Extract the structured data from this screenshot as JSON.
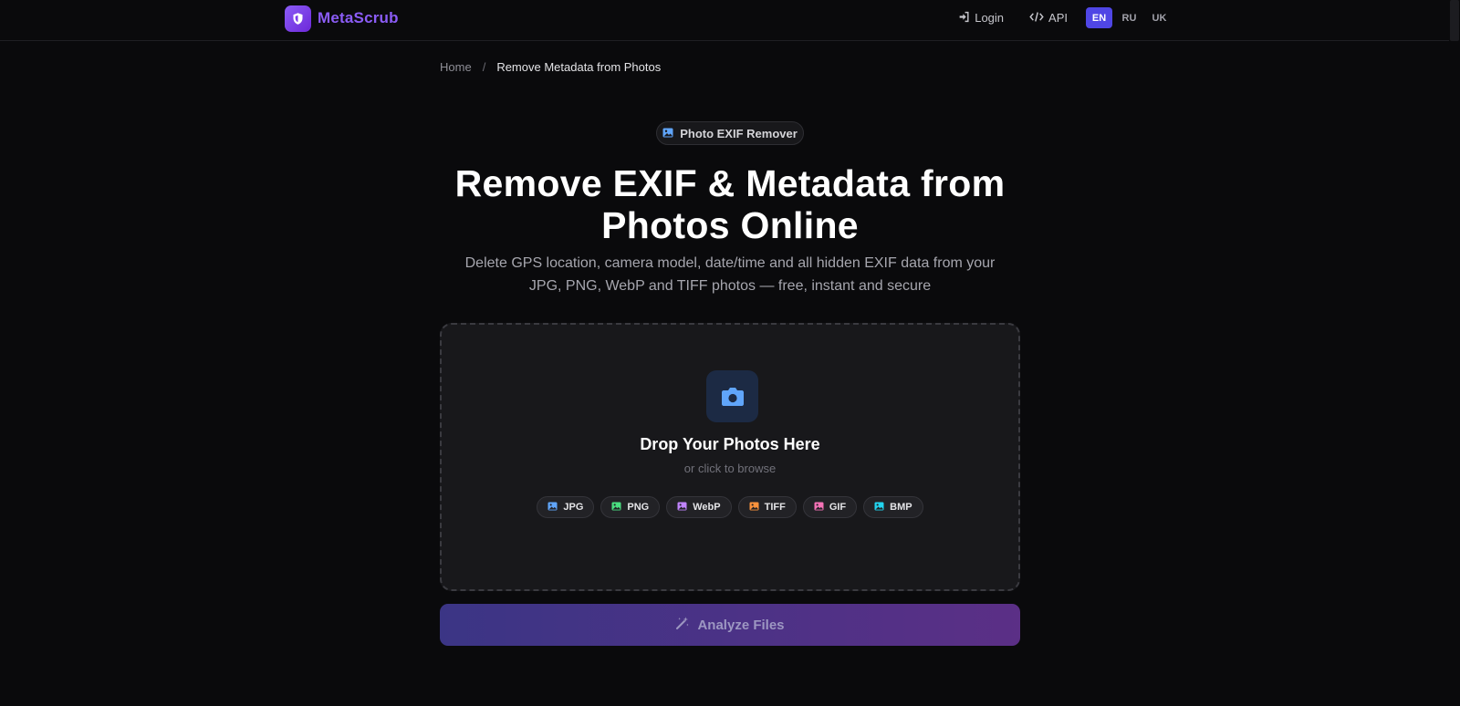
{
  "header": {
    "brand_name": "MetaScrub",
    "nav": {
      "login_label": "Login",
      "api_label": "API"
    },
    "languages": [
      {
        "code": "EN",
        "active": true
      },
      {
        "code": "RU",
        "active": false
      },
      {
        "code": "UK",
        "active": false
      }
    ]
  },
  "breadcrumb": {
    "home": "Home",
    "separator": "/",
    "current": "Remove Metadata from Photos"
  },
  "badge": {
    "label": "Photo EXIF Remover",
    "icon": "image-icon"
  },
  "hero": {
    "title_line1": "Remove EXIF & Metadata from",
    "title_line2": "Photos Online",
    "subtitle_line1": "Delete GPS location, camera model, date/time and all hidden EXIF data from your",
    "subtitle_line2": "JPG, PNG, WebP and TIFF photos — free, instant and secure"
  },
  "dropzone": {
    "icon": "camera-icon",
    "title": "Drop Your Photos Here",
    "subtitle": "or click to browse",
    "formats": [
      {
        "label": "JPG",
        "color": "#60a5fa"
      },
      {
        "label": "PNG",
        "color": "#4ade80"
      },
      {
        "label": "WebP",
        "color": "#c084fc"
      },
      {
        "label": "TIFF",
        "color": "#fb923c"
      },
      {
        "label": "GIF",
        "color": "#f472b6"
      },
      {
        "label": "BMP",
        "color": "#22d3ee"
      }
    ]
  },
  "analyze_button": {
    "label": "Analyze Files",
    "icon": "magic-wand-icon"
  },
  "colors": {
    "accent": "#8b5cf6",
    "active_lang": "#4f46e5",
    "camera_icon": "#60a5fa"
  }
}
